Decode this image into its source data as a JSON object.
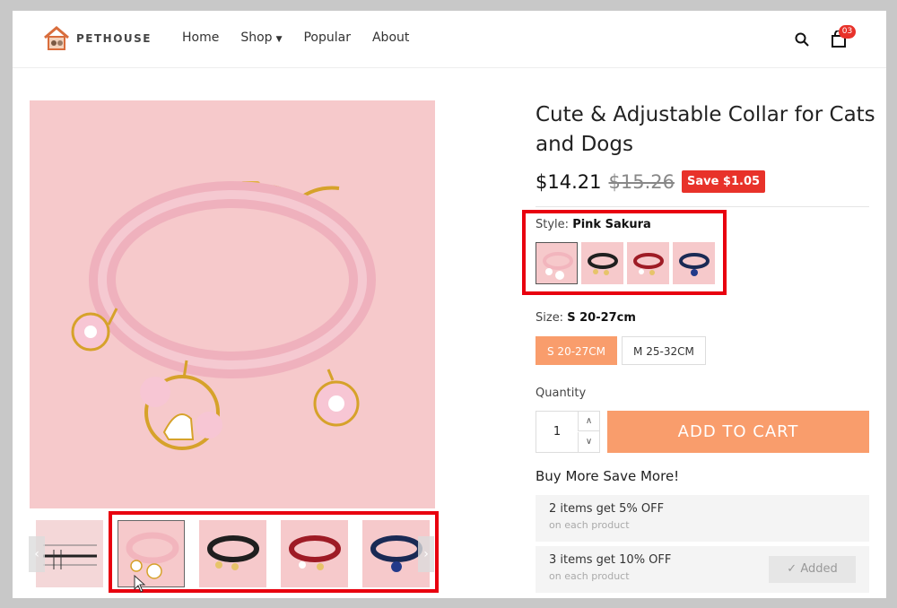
{
  "header": {
    "logo_text": "PETHOUSE",
    "nav": [
      {
        "label": "Home"
      },
      {
        "label": "Shop",
        "has_dropdown": true
      },
      {
        "label": "Popular"
      },
      {
        "label": "About"
      }
    ],
    "cart_count": "03",
    "icons": [
      "search-icon",
      "cart-icon",
      "chevron-down-icon"
    ]
  },
  "product": {
    "title": "Cute & Adjustable Collar for Cats and Dogs",
    "price": "$14.21",
    "compare_price": "$15.26",
    "save_label": "Save $1.05",
    "style": {
      "label": "Style:",
      "selected": "Pink Sakura",
      "options": [
        {
          "name": "pink-sakura",
          "band": "#f2b5bd",
          "charm": "#ffffff"
        },
        {
          "name": "black",
          "band": "#1f1f1f",
          "charm": "#e7c46a"
        },
        {
          "name": "red",
          "band": "#9e1b25",
          "charm": "#e7c46a"
        },
        {
          "name": "navy",
          "band": "#1a2a55",
          "charm": "#233a8a"
        }
      ]
    },
    "size": {
      "label": "Size:",
      "selected": "S 20-27cm",
      "options": [
        "S 20-27CM",
        "M 25-32CM"
      ]
    },
    "quantity": {
      "label": "Quantity",
      "value": "1"
    },
    "add_to_cart": "ADD TO CART",
    "bulk": {
      "title": "Buy More Save More!",
      "tiers": [
        {
          "main": "2 items get 5% OFF",
          "sub": "on each product",
          "added": false
        },
        {
          "main": "3 items get 10% OFF",
          "sub": "on each product",
          "added": true,
          "added_label": "Added"
        }
      ]
    }
  },
  "gallery": {
    "thumbnails": [
      "size-chart",
      "pink-sakura",
      "black",
      "red",
      "navy"
    ],
    "active_index": 1
  },
  "colors": {
    "accent": "#f99d6c",
    "sale_red": "#e8322a",
    "highlight_red": "#e8000f",
    "product_bg": "#f6c9cb"
  }
}
